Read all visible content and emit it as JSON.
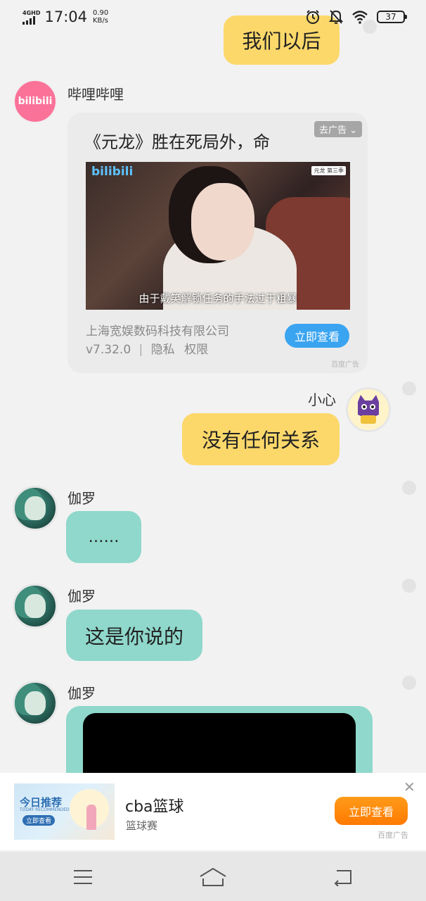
{
  "status_bar": {
    "network": "4GHD",
    "time": "17:04",
    "speed_value": "0.90",
    "speed_unit": "KB/s",
    "battery": "37",
    "icons": [
      "alarm-icon",
      "mute-icon",
      "wifi-icon",
      "battery-icon"
    ]
  },
  "chat": {
    "messages": [
      {
        "side": "right",
        "sender": "",
        "text": "我们以后",
        "color": "#fcd86b"
      },
      {
        "side": "left",
        "sender": "哔哩哔哩",
        "type": "ad"
      },
      {
        "side": "right",
        "sender": "小心",
        "text": "没有任何关系",
        "color": "#fcd86b"
      },
      {
        "side": "left",
        "sender": "伽罗",
        "text": "……",
        "color": "#8fd8cb"
      },
      {
        "side": "left",
        "sender": "伽罗",
        "text": "这是你说的",
        "color": "#8fd8cb"
      },
      {
        "side": "left",
        "sender": "伽罗",
        "type": "media"
      }
    ]
  },
  "ad_card": {
    "title": "《元龙》胜在死局外，命",
    "badge": "去广告",
    "image_logo": "bilibili",
    "image_tag": "元龙 第三季",
    "image_subtitle": "由于戴笑解锁任务的手法过于粗暴",
    "company": "上海宽娱数码科技有限公司",
    "version": "v7.32.0",
    "privacy": "隐私",
    "permissions": "权限",
    "button": "立即查看",
    "source": "百度广告"
  },
  "avatar_logo": "bilibili",
  "bottom_banner": {
    "thumb_title": "今日推荐",
    "thumb_subtitle": "TODAY RECOMMENDED",
    "thumb_button": "立即查看",
    "title": "cba篮球",
    "subtitle": "篮球赛",
    "button": "立即查看",
    "source": "百度广告",
    "close": "✕"
  },
  "colors": {
    "accent_blue": "#3aa4f0",
    "orange_button": "#ff8a00",
    "yellow_bubble": "#fcd86b",
    "teal_bubble": "#8fd8cb",
    "bilibili_pink": "#fb7299"
  }
}
